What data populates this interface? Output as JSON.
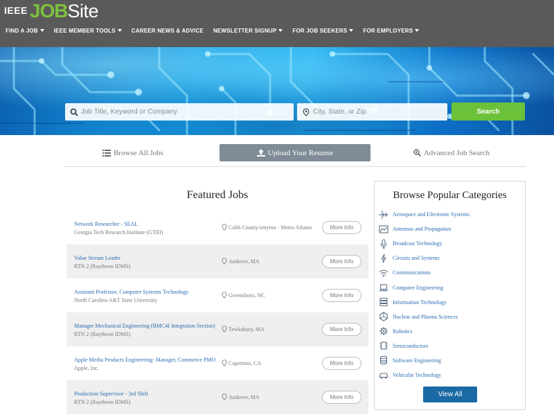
{
  "header": {
    "logo_prefix": "IEEE",
    "logo_job": "JOB",
    "logo_site": "Site",
    "nav": [
      {
        "label": "FIND A JOB",
        "dropdown": true
      },
      {
        "label": "IEEE MEMBER TOOLS",
        "dropdown": true
      },
      {
        "label": "CAREER NEWS & ADVICE",
        "dropdown": false
      },
      {
        "label": "NEWSLETTER SIGNUP",
        "dropdown": true
      },
      {
        "label": "FOR JOB SEEKERS",
        "dropdown": true
      },
      {
        "label": "FOR EMPLOYERS",
        "dropdown": true
      }
    ]
  },
  "search": {
    "keyword_placeholder": "Job Title, Keyword or Company",
    "keyword_value": "",
    "location_placeholder": "City, State, or Zip",
    "location_value": "",
    "button_label": "Search"
  },
  "actions": {
    "browse_label": "Browse All Jobs",
    "upload_label": "Upload Your Resume",
    "advanced_label": "Advanced Job Search"
  },
  "featured": {
    "title": "Featured Jobs",
    "more_label": "More Info",
    "jobs": [
      {
        "title": "Network Researcher - SEAL",
        "company": "Georgia Tech Research Institute (GTRI)",
        "location": "Cobb County/smyrna - Metro Atlanta"
      },
      {
        "title": "Value Stream Leader",
        "company": "RTN 2 (Raytheon IDMS)",
        "location": "Andover, MA"
      },
      {
        "title": "Assistant Professor, Computer Systems Technology",
        "company": "North Carolina A&T State University",
        "location": "Greensboro, NC"
      },
      {
        "title": "Manager Mechanical Engineering (BMC4I Integration Section)",
        "company": "RTN 2 (Raytheon IDMS)",
        "location": "Tewksbury, MA"
      },
      {
        "title": "Apple Media Products Engineering- Manager, Commerce PMO",
        "company": "Apple, Inc.",
        "location": "Cupertino, CA"
      },
      {
        "title": "Production Supervisor - 3rd Shift",
        "company": "RTN 2 (Raytheon IDMS)",
        "location": "Andover, MA"
      }
    ]
  },
  "categories": {
    "title": "Browse Popular Categories",
    "view_all_label": "View All",
    "items": [
      {
        "label": "Aerospace and Electronic Systems",
        "icon": "airplane-icon"
      },
      {
        "label": "Antennas and Propagation",
        "icon": "chart-icon"
      },
      {
        "label": "Broadcast Technology",
        "icon": "microphone-icon"
      },
      {
        "label": "Circuits and Systems",
        "icon": "lightning-icon"
      },
      {
        "label": "Communications",
        "icon": "wifi-icon"
      },
      {
        "label": "Computer Engineering",
        "icon": "laptop-icon"
      },
      {
        "label": "Information Technology",
        "icon": "server-icon"
      },
      {
        "label": "Nuclear and Plasma Sciences",
        "icon": "atom-icon"
      },
      {
        "label": "Robotics",
        "icon": "gear-icon"
      },
      {
        "label": "Semiconductors",
        "icon": "chip-icon"
      },
      {
        "label": "Software Engineering",
        "icon": "database-icon"
      },
      {
        "label": "Vehicular Technology",
        "icon": "car-icon"
      }
    ]
  },
  "colors": {
    "header_bg": "#5a5a5a",
    "logo_green": "#7dc13c",
    "search_green": "#6cc13a",
    "link_blue": "#2a6cb0",
    "view_all_blue": "#1b6aa5",
    "upload_gray": "#7f8b96"
  }
}
